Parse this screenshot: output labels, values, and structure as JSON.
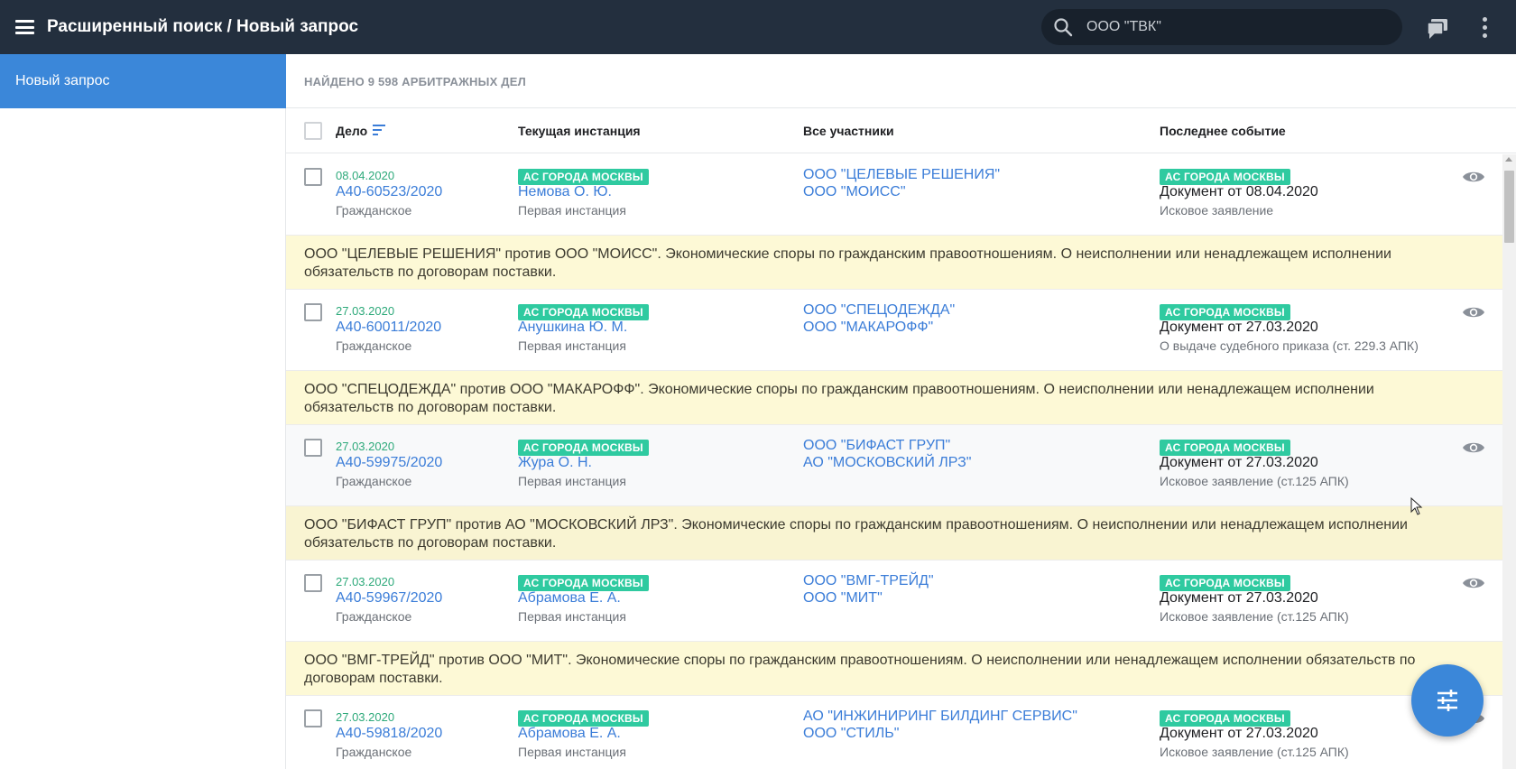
{
  "header": {
    "title": "Расширенный поиск / Новый запрос",
    "search_value": "ООО \"ТВК\"",
    "icons": [
      "menu-icon",
      "search-icon",
      "chat-icon",
      "more-vert-icon"
    ]
  },
  "sidebar": {
    "items": [
      {
        "label": "Новый запрос",
        "active": true
      }
    ]
  },
  "results": {
    "found_label": "НАЙДЕНО 9 598 АРБИТРАЖНЫХ ДЕЛ"
  },
  "table": {
    "columns": {
      "case": "Дело",
      "instance": "Текущая инстанция",
      "participants": "Все участники",
      "event": "Последнее событие"
    },
    "rows": [
      {
        "date": "08.04.2020",
        "number": "А40-60523/2020",
        "type": "Гражданское",
        "court": "АС ГОРОДА МОСКВЫ",
        "judge": "Немова О. Ю.",
        "instance": "Первая инстанция",
        "party1": "ООО \"ЦЕЛЕВЫЕ РЕШЕНИЯ\"",
        "party2": "ООО \"МОИСС\"",
        "event_court": "АС ГОРОДА МОСКВЫ",
        "event_doc": "Документ от 08.04.2020",
        "event_desc": "Исковое заявление",
        "summary": "ООО \"ЦЕЛЕВЫЕ РЕШЕНИЯ\" против ООО \"МОИСС\". Экономические споры по гражданским правоотношениям. О неисполнении или ненадлежащем исполнении обязательств по договорам поставки."
      },
      {
        "date": "27.03.2020",
        "number": "А40-60011/2020",
        "type": "Гражданское",
        "court": "АС ГОРОДА МОСКВЫ",
        "judge": "Анушкина Ю. М.",
        "instance": "Первая инстанция",
        "party1": "ООО \"СПЕЦОДЕЖДА\"",
        "party2": "ООО \"МАКАРОФФ\"",
        "event_court": "АС ГОРОДА МОСКВЫ",
        "event_doc": "Документ от 27.03.2020",
        "event_desc": "О выдаче судебного приказа (ст. 229.3 АПК)",
        "summary": "ООО \"СПЕЦОДЕЖДА\" против ООО \"МАКАРОФФ\". Экономические споры по гражданским правоотношениям. О неисполнении или ненадлежащем исполнении обязательств по договорам поставки."
      },
      {
        "date": "27.03.2020",
        "number": "А40-59975/2020",
        "type": "Гражданское",
        "court": "АС ГОРОДА МОСКВЫ",
        "judge": "Жура О. Н.",
        "instance": "Первая инстанция",
        "party1": "ООО \"БИФАСТ ГРУП\"",
        "party2": "АО \"МОСКОВСКИЙ ЛРЗ\"",
        "event_court": "АС ГОРОДА МОСКВЫ",
        "event_doc": "Документ от 27.03.2020",
        "event_desc": "Исковое заявление (ст.125 АПК)",
        "summary": "ООО \"БИФАСТ ГРУП\" против АО \"МОСКОВСКИЙ ЛРЗ\". Экономические споры по гражданским правоотношениям. О неисполнении или ненадлежащем исполнении обязательств по договорам поставки."
      },
      {
        "date": "27.03.2020",
        "number": "А40-59967/2020",
        "type": "Гражданское",
        "court": "АС ГОРОДА МОСКВЫ",
        "judge": "Абрамова Е. А.",
        "instance": "Первая инстанция",
        "party1": "ООО \"ВМГ-ТРЕЙД\"",
        "party2": "ООО \"МИТ\"",
        "event_court": "АС ГОРОДА МОСКВЫ",
        "event_doc": "Документ от 27.03.2020",
        "event_desc": "Исковое заявление (ст.125 АПК)",
        "summary": "ООО \"ВМГ-ТРЕЙД\" против ООО \"МИТ\". Экономические споры по гражданским правоотношениям. О неисполнении или ненадлежащем исполнении обязательств по договорам поставки."
      },
      {
        "date": "27.03.2020",
        "number": "А40-59818/2020",
        "type": "Гражданское",
        "court": "АС ГОРОДА МОСКВЫ",
        "judge": "Абрамова Е. А.",
        "instance": "Первая инстанция",
        "party1": "АО \"ИНЖИНИРИНГ БИЛДИНГ СЕРВИС\"",
        "party2": "ООО \"СТИЛЬ\"",
        "event_court": "АС ГОРОДА МОСКВЫ",
        "event_doc": "Документ от 27.03.2020",
        "event_desc": "Исковое заявление (ст.125 АПК)",
        "summary": ""
      }
    ]
  },
  "fab": {
    "icon": "tune-icon"
  },
  "colors": {
    "topbar": "#232f3e",
    "accent": "#3b87d9",
    "link": "#3b7dd8",
    "date": "#2da97a",
    "badge": "#2fcaa0",
    "summary_bg": "#fdf9d6"
  }
}
